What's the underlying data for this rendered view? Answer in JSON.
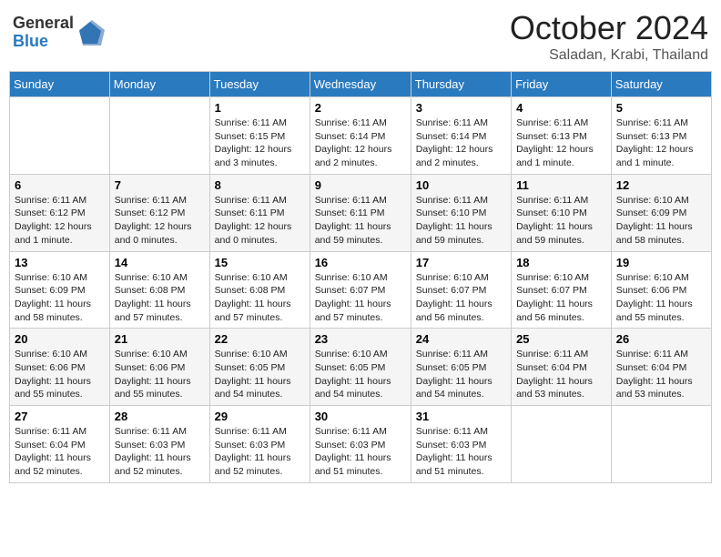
{
  "logo": {
    "general": "General",
    "blue": "Blue"
  },
  "header": {
    "month": "October 2024",
    "location": "Saladan, Krabi, Thailand"
  },
  "weekdays": [
    "Sunday",
    "Monday",
    "Tuesday",
    "Wednesday",
    "Thursday",
    "Friday",
    "Saturday"
  ],
  "weeks": [
    [
      {
        "day": "",
        "info": ""
      },
      {
        "day": "",
        "info": ""
      },
      {
        "day": "1",
        "info": "Sunrise: 6:11 AM\nSunset: 6:15 PM\nDaylight: 12 hours and 3 minutes."
      },
      {
        "day": "2",
        "info": "Sunrise: 6:11 AM\nSunset: 6:14 PM\nDaylight: 12 hours and 2 minutes."
      },
      {
        "day": "3",
        "info": "Sunrise: 6:11 AM\nSunset: 6:14 PM\nDaylight: 12 hours and 2 minutes."
      },
      {
        "day": "4",
        "info": "Sunrise: 6:11 AM\nSunset: 6:13 PM\nDaylight: 12 hours and 1 minute."
      },
      {
        "day": "5",
        "info": "Sunrise: 6:11 AM\nSunset: 6:13 PM\nDaylight: 12 hours and 1 minute."
      }
    ],
    [
      {
        "day": "6",
        "info": "Sunrise: 6:11 AM\nSunset: 6:12 PM\nDaylight: 12 hours and 1 minute."
      },
      {
        "day": "7",
        "info": "Sunrise: 6:11 AM\nSunset: 6:12 PM\nDaylight: 12 hours and 0 minutes."
      },
      {
        "day": "8",
        "info": "Sunrise: 6:11 AM\nSunset: 6:11 PM\nDaylight: 12 hours and 0 minutes."
      },
      {
        "day": "9",
        "info": "Sunrise: 6:11 AM\nSunset: 6:11 PM\nDaylight: 11 hours and 59 minutes."
      },
      {
        "day": "10",
        "info": "Sunrise: 6:11 AM\nSunset: 6:10 PM\nDaylight: 11 hours and 59 minutes."
      },
      {
        "day": "11",
        "info": "Sunrise: 6:11 AM\nSunset: 6:10 PM\nDaylight: 11 hours and 59 minutes."
      },
      {
        "day": "12",
        "info": "Sunrise: 6:10 AM\nSunset: 6:09 PM\nDaylight: 11 hours and 58 minutes."
      }
    ],
    [
      {
        "day": "13",
        "info": "Sunrise: 6:10 AM\nSunset: 6:09 PM\nDaylight: 11 hours and 58 minutes."
      },
      {
        "day": "14",
        "info": "Sunrise: 6:10 AM\nSunset: 6:08 PM\nDaylight: 11 hours and 57 minutes."
      },
      {
        "day": "15",
        "info": "Sunrise: 6:10 AM\nSunset: 6:08 PM\nDaylight: 11 hours and 57 minutes."
      },
      {
        "day": "16",
        "info": "Sunrise: 6:10 AM\nSunset: 6:07 PM\nDaylight: 11 hours and 57 minutes."
      },
      {
        "day": "17",
        "info": "Sunrise: 6:10 AM\nSunset: 6:07 PM\nDaylight: 11 hours and 56 minutes."
      },
      {
        "day": "18",
        "info": "Sunrise: 6:10 AM\nSunset: 6:07 PM\nDaylight: 11 hours and 56 minutes."
      },
      {
        "day": "19",
        "info": "Sunrise: 6:10 AM\nSunset: 6:06 PM\nDaylight: 11 hours and 55 minutes."
      }
    ],
    [
      {
        "day": "20",
        "info": "Sunrise: 6:10 AM\nSunset: 6:06 PM\nDaylight: 11 hours and 55 minutes."
      },
      {
        "day": "21",
        "info": "Sunrise: 6:10 AM\nSunset: 6:06 PM\nDaylight: 11 hours and 55 minutes."
      },
      {
        "day": "22",
        "info": "Sunrise: 6:10 AM\nSunset: 6:05 PM\nDaylight: 11 hours and 54 minutes."
      },
      {
        "day": "23",
        "info": "Sunrise: 6:10 AM\nSunset: 6:05 PM\nDaylight: 11 hours and 54 minutes."
      },
      {
        "day": "24",
        "info": "Sunrise: 6:11 AM\nSunset: 6:05 PM\nDaylight: 11 hours and 54 minutes."
      },
      {
        "day": "25",
        "info": "Sunrise: 6:11 AM\nSunset: 6:04 PM\nDaylight: 11 hours and 53 minutes."
      },
      {
        "day": "26",
        "info": "Sunrise: 6:11 AM\nSunset: 6:04 PM\nDaylight: 11 hours and 53 minutes."
      }
    ],
    [
      {
        "day": "27",
        "info": "Sunrise: 6:11 AM\nSunset: 6:04 PM\nDaylight: 11 hours and 52 minutes."
      },
      {
        "day": "28",
        "info": "Sunrise: 6:11 AM\nSunset: 6:03 PM\nDaylight: 11 hours and 52 minutes."
      },
      {
        "day": "29",
        "info": "Sunrise: 6:11 AM\nSunset: 6:03 PM\nDaylight: 11 hours and 52 minutes."
      },
      {
        "day": "30",
        "info": "Sunrise: 6:11 AM\nSunset: 6:03 PM\nDaylight: 11 hours and 51 minutes."
      },
      {
        "day": "31",
        "info": "Sunrise: 6:11 AM\nSunset: 6:03 PM\nDaylight: 11 hours and 51 minutes."
      },
      {
        "day": "",
        "info": ""
      },
      {
        "day": "",
        "info": ""
      }
    ]
  ]
}
